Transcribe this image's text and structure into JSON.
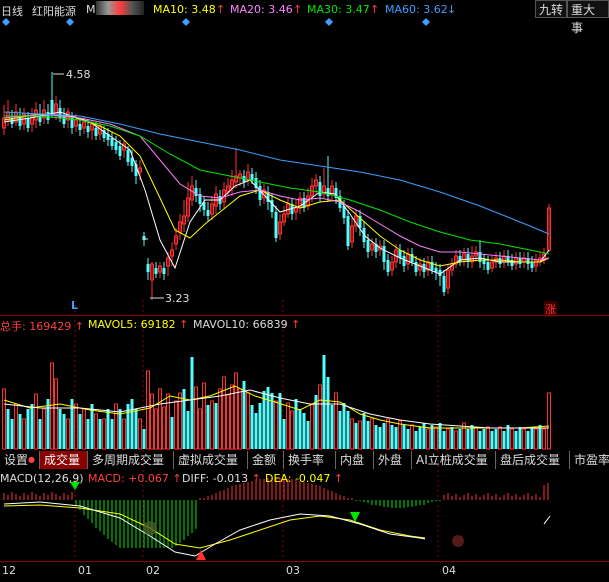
{
  "header": {
    "period": "日线",
    "stock_name": "红阳能源",
    "ma_prefix": "M",
    "ma10_label": "MA10: 3.48",
    "ma20_label": "MA20: 3.46",
    "ma30_label": "MA30: 3.47",
    "ma60_label": "MA60: 3.62",
    "btn_jiuzhuan": "九转",
    "btn_major": "重大事"
  },
  "price_panel": {
    "high_label": "4.58",
    "low_label": "3.23",
    "l_marker": "L",
    "zhang_badge": "涨"
  },
  "volume_panel": {
    "total_label": "总手: 169429",
    "mavol5_label": "MAVOL5: 69182",
    "mavol10_label": "MAVOL10: 66839"
  },
  "tabs": [
    {
      "label": "设置"
    },
    {
      "label": "成交量"
    },
    {
      "label": "多周期成交量"
    },
    {
      "label": "虚拟成交量"
    },
    {
      "label": "金额"
    },
    {
      "label": "换手率"
    },
    {
      "label": "内盘"
    },
    {
      "label": "外盘"
    },
    {
      "label": "AI立桩成交量"
    },
    {
      "label": "盘后成交量"
    },
    {
      "label": "市盈率"
    }
  ],
  "macd_panel": {
    "params_label": "MACD(12,26,9)",
    "macd_label": "MACD: +0.067",
    "diff_label": "DIFF: -0.013",
    "dea_label": "DEA: -0.047"
  },
  "x_axis": {
    "labels": [
      "12",
      "01",
      "02",
      "03",
      "04"
    ]
  },
  "colors": {
    "up": "#ff3232",
    "down": "#54fcfc",
    "ma5": "#ffffff",
    "ma10": "#ffff00",
    "ma20": "#ff80ff",
    "ma30": "#00e600",
    "ma60": "#3ca0ff",
    "grid_red": "#8b0000"
  }
}
